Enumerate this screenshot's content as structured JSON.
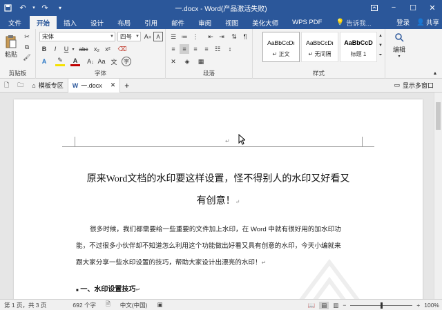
{
  "titlebar": {
    "title": "一.docx - Word(产品激活失败)",
    "save_icon": "save-icon",
    "undo_icon": "undo-icon",
    "redo_icon": "redo-icon",
    "customize_icon": "customize-icon"
  },
  "tabs": [
    "文件",
    "开始",
    "插入",
    "设计",
    "布局",
    "引用",
    "邮件",
    "审阅",
    "视图",
    "美化大师",
    "WPS PDF"
  ],
  "active_tab": "开始",
  "tell_me": "告诉我...",
  "login": "登录",
  "share": "共享",
  "ribbon": {
    "clipboard": {
      "paste": "粘贴",
      "label": "剪贴板"
    },
    "font": {
      "font_name": "宋体",
      "font_size": "四号",
      "label": "字体",
      "bold": "B",
      "italic": "I",
      "underline": "U",
      "strike": "abc",
      "sub": "x₂",
      "sup": "x²",
      "font_color": "A",
      "clear": "A"
    },
    "paragraph": {
      "label": "段落"
    },
    "styles": {
      "label": "样式",
      "items": [
        {
          "preview": "AaBbCcDı",
          "name": "↵ 正文"
        },
        {
          "preview": "AaBbCcDı",
          "name": "↵ 无间隔"
        },
        {
          "preview": "AaBbCcD",
          "name": "标题 1"
        }
      ]
    },
    "editing": {
      "label": "编辑"
    }
  },
  "doctabs": {
    "template": "模板专区",
    "doc": "一.docx",
    "show_multi": "显示多窗口"
  },
  "document": {
    "title_line1": "原来Word文档的水印要这样设置，怪不得别人的水印又好看又",
    "title_line2": "有创意！",
    "para1_line1": "很多时候，我们都需要给一些重要的文件加上水印，在 Word 中就有很好用的加水印功",
    "para1_line2": "能，不过很多小伙伴却不知道怎么利用这个功能做出好看又具有创意的水印，今天小编就来",
    "para1_line3": "跟大家分享一些水印设置的技巧，帮助大家设计出漂亮的水印！",
    "heading1": "一、水印设置技巧",
    "para_mark": "↵"
  },
  "statusbar": {
    "page": "第 1 页，共 3 页",
    "words": "692 个字",
    "lang": "中文(中国)",
    "zoom": "100%",
    "zoom_minus": "−",
    "zoom_plus": "+"
  }
}
